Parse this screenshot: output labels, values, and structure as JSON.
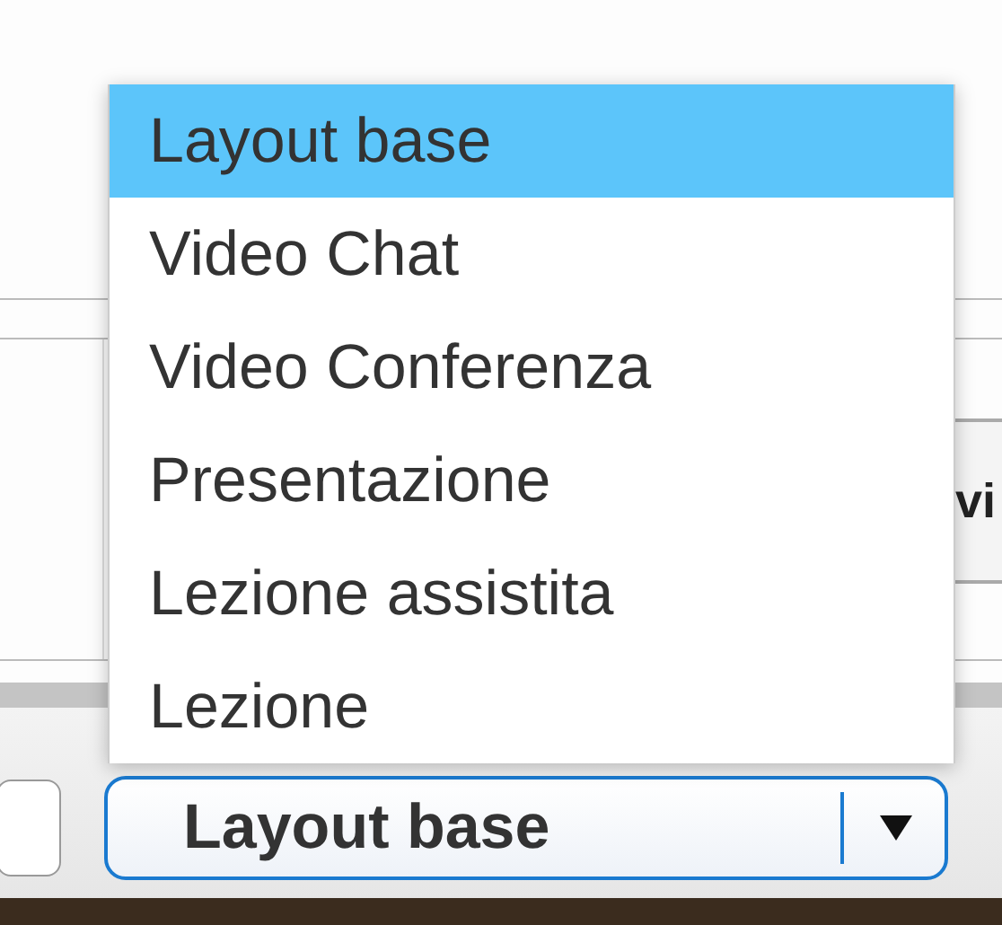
{
  "background_panel": {
    "label": "vi"
  },
  "layout_select": {
    "value": "Layout base",
    "expanded": true
  },
  "layout_menu": {
    "options": [
      {
        "label": "Layout base",
        "selected": true
      },
      {
        "label": "Video Chat",
        "selected": false
      },
      {
        "label": "Video Conferenza",
        "selected": false
      },
      {
        "label": "Presentazione",
        "selected": false
      },
      {
        "label": "Lezione assistita",
        "selected": false
      },
      {
        "label": "Lezione",
        "selected": false
      }
    ]
  }
}
